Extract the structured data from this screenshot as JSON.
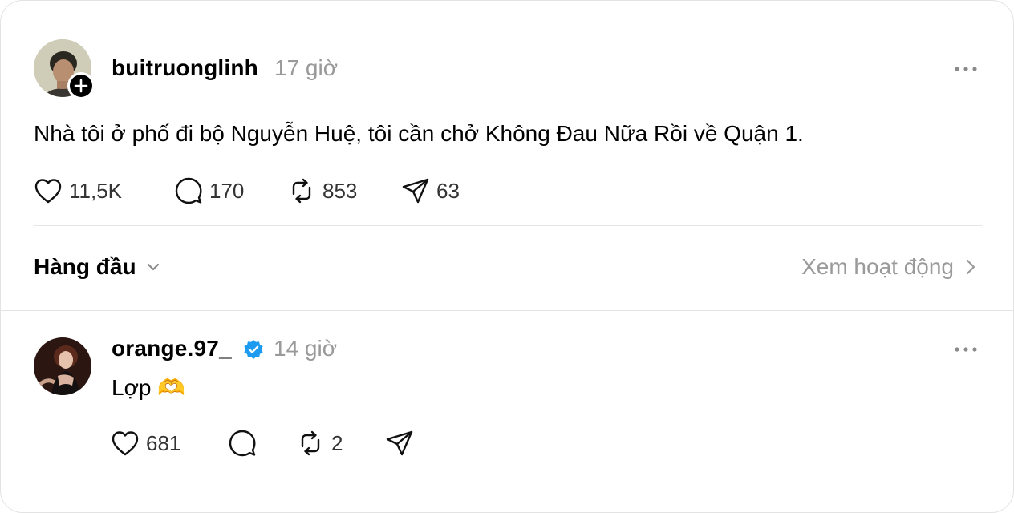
{
  "post": {
    "username": "buitruonglinh",
    "time": "17 giờ",
    "text": "Nhà tôi ở phố đi bộ Nguyễn Huệ, tôi cần chở Không Đau Nữa Rồi về Quận 1.",
    "likes": "11,5K",
    "comments": "170",
    "reposts": "853",
    "shares": "63",
    "icons": [
      "avatar",
      "follow-plus-icon",
      "more-options-icon",
      "heart-icon",
      "comment-icon",
      "repost-icon",
      "share-icon"
    ]
  },
  "replies_bar": {
    "sort_label": "Hàng đầu",
    "activity_label": "Xem hoạt động",
    "icons": [
      "chevron-down-icon",
      "chevron-right-icon"
    ]
  },
  "reply": {
    "username": "orange.97_",
    "time": "14 giờ",
    "text": "Lợp 🫶",
    "likes": "681",
    "reposts": "2",
    "icons": [
      "avatar",
      "verified-badge-icon",
      "more-options-icon",
      "heart-icon",
      "comment-icon",
      "repost-icon",
      "share-icon"
    ]
  },
  "colors": {
    "verified": "#1d9bf0",
    "muted_text": "#999999",
    "divider": "#e5e5e5"
  }
}
